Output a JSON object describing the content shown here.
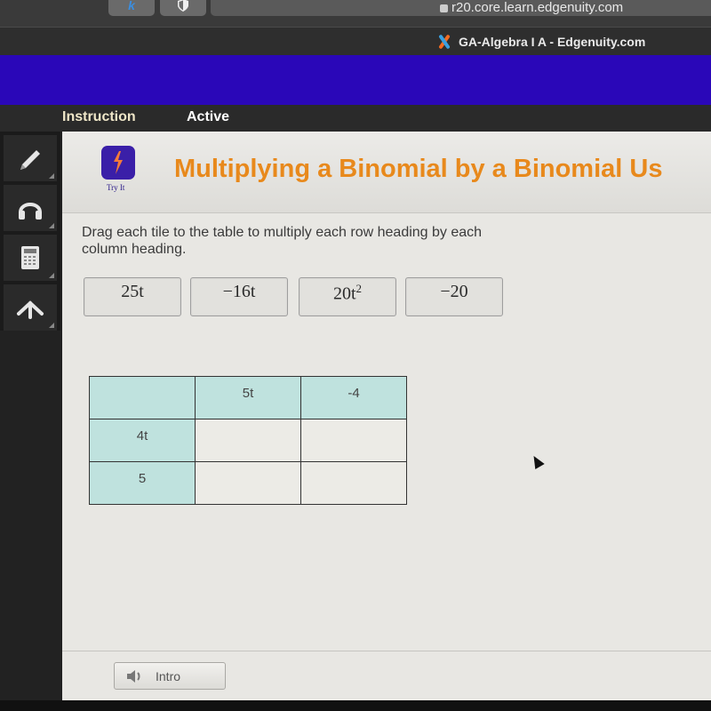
{
  "browser": {
    "url": "r20.core.learn.edgenuity.com",
    "tab_title": "GA-Algebra I A - Edgenuity.com",
    "icons": {
      "extension_1": "script-k-icon",
      "extension_2": "shield-icon",
      "lock": "lock-icon",
      "favicon": "edgenuity-x-icon"
    }
  },
  "nav": {
    "instruction_label": "Instruction",
    "active_label": "Active"
  },
  "toolbar": {
    "tools": [
      {
        "name": "pencil",
        "icon": "pencil-icon"
      },
      {
        "name": "audio",
        "icon": "headphones-icon"
      },
      {
        "name": "calculator",
        "icon": "calculator-icon"
      },
      {
        "name": "collapse",
        "icon": "arrow-up-icon"
      }
    ]
  },
  "lesson": {
    "activity_type": "Try It",
    "title": "Multiplying a Binomial by a Binomial Us",
    "instructions": "Drag each tile to the table to multiply each row heading by each column heading."
  },
  "tiles": [
    {
      "base": "25t",
      "exp": ""
    },
    {
      "base": "−16t",
      "exp": ""
    },
    {
      "base": "20t",
      "exp": "2"
    },
    {
      "base": "−20",
      "exp": ""
    }
  ],
  "table": {
    "corner": "",
    "column_headings": [
      "5t",
      "-4"
    ],
    "rows": [
      {
        "heading": "4t",
        "cells": [
          "",
          ""
        ]
      },
      {
        "heading": "5",
        "cells": [
          "",
          ""
        ]
      }
    ]
  },
  "footer": {
    "intro_label": "Intro",
    "intro_icon": "speaker-icon"
  },
  "colors": {
    "banner": "#2a07b8",
    "title": "#e8891c",
    "table_heading": "#bfe2de",
    "tryit_icon": "#3a1fa8"
  }
}
